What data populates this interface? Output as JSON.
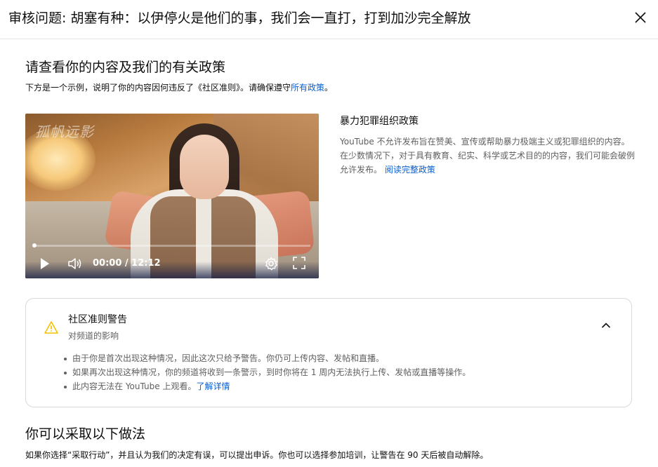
{
  "header": {
    "title": "审核问题: 胡塞有种：以伊停火是他们的事，我们会一直打，打到加沙完全解放"
  },
  "review": {
    "title": "请查看你的内容及我们的有关政策",
    "desc_prefix": "下方是一个示例，说明了你的内容因何违反了《社区准则》。请确保遵守",
    "desc_link": "所有政策",
    "desc_suffix": "。"
  },
  "video": {
    "watermark": "孤帆远影",
    "time": "00:00 / 12:12",
    "progress": 0.0
  },
  "policy": {
    "title": "暴力犯罪组织政策",
    "description": "YouTube 不允许发布旨在赞美、宣传或帮助暴力极端主义或犯罪组织的内容。在少数情况下，对于具有教育、纪实、科学或艺术目的的内容，我们可能会破例允许发布。",
    "link": "阅读完整政策"
  },
  "warning": {
    "title": "社区准则警告",
    "subtitle": "对频道的影响",
    "items": [
      "由于你是首次出现这种情况，因此这次只给予警告。你仍可上传内容、发帖和直播。",
      "如果再次出现这种情况，你的频道将收到一条警示，到时你将在 1 周内无法执行上传、发帖或直播等操作。"
    ],
    "last_item_text": "此内容无法在 YouTube 上观看。",
    "last_item_link": "了解详情"
  },
  "actions": {
    "title": "你可以采取以下做法",
    "desc": "如果你选择“采取行动”，并且认为我们的决定有误，可以提出申诉。你也可以选择参加培训，让警告在 90 天后被自动解除。"
  },
  "colors": {
    "link": "#065fd4",
    "warning_icon": "#f2c200",
    "secondary_text": "#606060"
  },
  "icons": [
    "close-icon",
    "play-icon",
    "volume-icon",
    "settings-icon",
    "fullscreen-icon",
    "warning-icon",
    "chevron-up-icon"
  ]
}
